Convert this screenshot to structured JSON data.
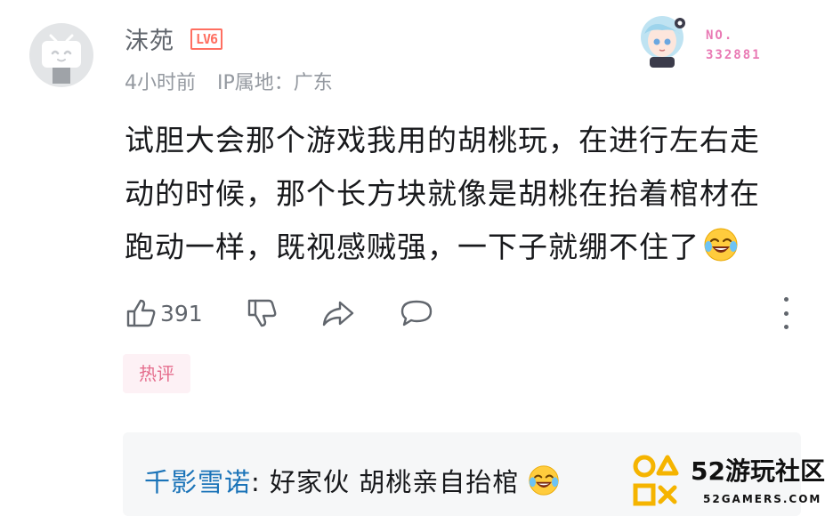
{
  "comment": {
    "username": "沫苑",
    "level": "LV6",
    "time": "4小时前",
    "ip_location": "IP属地：广东",
    "fan_badge": {
      "label": "NO.",
      "number": "332881"
    },
    "text": "试胆大会那个游戏我用的胡桃玩，在进行左右走动的时候，那个长方块就像是胡桃在抬着棺材在跑动一样，既视感贼强，一下子就绷不住了",
    "emoji_icon": "laugh-cry-emoji-icon",
    "actions": {
      "like_count": "391"
    },
    "hot_tag": "热评"
  },
  "reply": {
    "username": "千影雪诺",
    "separator": ":",
    "text": "好家伙  胡桃亲自抬棺",
    "emoji_icon": "laugh-cry-emoji-icon"
  },
  "watermark": {
    "title": "52游玩社区",
    "subtitle": "52GAMERS.COM"
  },
  "colors": {
    "username": "#61666d",
    "meta": "#9499a0",
    "level": "#ff6f61",
    "hot_tag_text": "#e56d8d",
    "hot_tag_bg": "#fdf1f5",
    "reply_name": "#1a73b8",
    "badge_number": "#e979b4"
  }
}
